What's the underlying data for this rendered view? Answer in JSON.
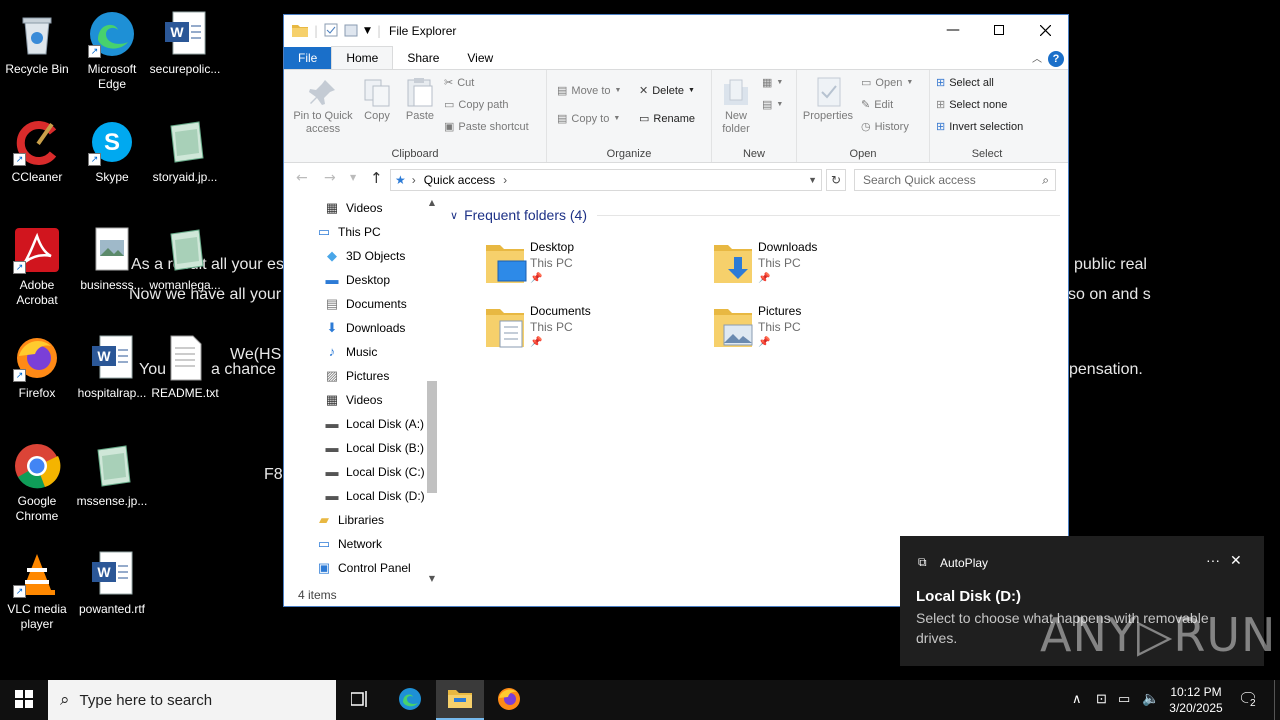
{
  "desktop": {
    "ransom_lines": [
      {
        "text": "As a result all your es",
        "id": "l1"
      },
      {
        "text": "Now we have all your",
        "id": "l2"
      },
      {
        "text": "We(HS",
        "id": "l3"
      },
      {
        "text": "You",
        "id": "l4"
      },
      {
        "text": "a chance",
        "id": "l5"
      },
      {
        "text": "F8",
        "id": "l6"
      },
      {
        "text": "public real",
        "id": "r1"
      },
      {
        "text": "so on and s",
        "id": "r2"
      },
      {
        "text": "pensation.",
        "id": "r3"
      }
    ],
    "icons": [
      {
        "label": "Recycle Bin"
      },
      {
        "label": "Microsoft Edge"
      },
      {
        "label": "securepolic..."
      },
      {
        "label": "CCleaner"
      },
      {
        "label": "Skype"
      },
      {
        "label": "storyaid.jp..."
      },
      {
        "label": "Adobe Acrobat"
      },
      {
        "label": "businesss..."
      },
      {
        "label": "womanlega..."
      },
      {
        "label": "Firefox"
      },
      {
        "label": "hospitalrap..."
      },
      {
        "label": "README.txt"
      },
      {
        "label": "Google Chrome"
      },
      {
        "label": "mssense.jp..."
      },
      {
        "label": "VLC media player"
      },
      {
        "label": "powanted.rtf"
      }
    ]
  },
  "explorer": {
    "title": "File Explorer",
    "tabs": [
      "File",
      "Home",
      "Share",
      "View"
    ],
    "ribbon": {
      "clipboard": {
        "name": "Clipboard",
        "pin": "Pin to Quick access",
        "copy": "Copy",
        "paste": "Paste",
        "cut": "Cut",
        "copy_path": "Copy path",
        "paste_shortcut": "Paste shortcut"
      },
      "organize": {
        "name": "Organize",
        "move_to": "Move to",
        "copy_to": "Copy to",
        "delete": "Delete",
        "rename": "Rename"
      },
      "new": {
        "name": "New",
        "new_folder": "New folder"
      },
      "open": {
        "name": "Open",
        "properties": "Properties",
        "open": "Open",
        "edit": "Edit",
        "history": "History"
      },
      "select": {
        "name": "Select",
        "select_all": "Select all",
        "select_none": "Select none",
        "invert": "Invert selection"
      }
    },
    "address": "Quick access",
    "search_placeholder": "Search Quick access",
    "nav_items": [
      {
        "label": "Videos",
        "icon": "video-icon",
        "indent": 1
      },
      {
        "label": "This PC",
        "icon": "pc-icon",
        "indent": 0
      },
      {
        "label": "3D Objects",
        "icon": "cube-icon",
        "indent": 1
      },
      {
        "label": "Desktop",
        "icon": "desktop-icon",
        "indent": 1
      },
      {
        "label": "Documents",
        "icon": "documents-icon",
        "indent": 1
      },
      {
        "label": "Downloads",
        "icon": "download-icon",
        "indent": 1
      },
      {
        "label": "Music",
        "icon": "music-icon",
        "indent": 1
      },
      {
        "label": "Pictures",
        "icon": "pictures-icon",
        "indent": 1
      },
      {
        "label": "Videos",
        "icon": "video-icon",
        "indent": 1
      },
      {
        "label": "Local Disk (A:)",
        "icon": "drive-icon",
        "indent": 1
      },
      {
        "label": "Local Disk (B:)",
        "icon": "drive-icon",
        "indent": 1
      },
      {
        "label": "Local Disk (C:)",
        "icon": "drive-icon",
        "indent": 1
      },
      {
        "label": "Local Disk (D:)",
        "icon": "drive-icon",
        "indent": 1
      },
      {
        "label": "Libraries",
        "icon": "library-icon",
        "indent": 0
      },
      {
        "label": "Network",
        "icon": "network-icon",
        "indent": 0
      },
      {
        "label": "Control Panel",
        "icon": "control-panel-icon",
        "indent": 0
      }
    ],
    "section_title": "Frequent folders (4)",
    "folders": [
      {
        "name": "Desktop",
        "location": "This PC"
      },
      {
        "name": "Downloads",
        "location": "This PC"
      },
      {
        "name": "Documents",
        "location": "This PC"
      },
      {
        "name": "Pictures",
        "location": "This PC"
      }
    ],
    "status": "4 items"
  },
  "notification": {
    "app": "AutoPlay",
    "title": "Local Disk (D:)",
    "body": "Select to choose what happens with removable drives.",
    "watermark": "ANY RUN"
  },
  "taskbar": {
    "search_placeholder": "Type here to search",
    "time": "10:12 PM",
    "date": "3/20/2025",
    "notification_count": "2"
  }
}
